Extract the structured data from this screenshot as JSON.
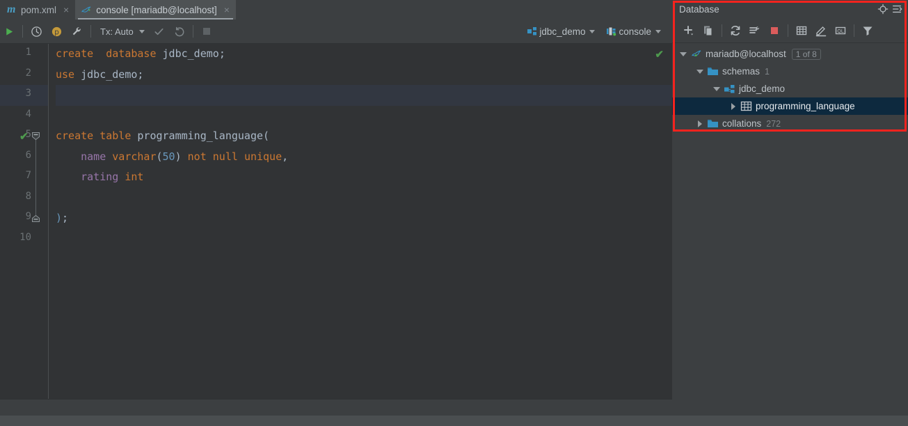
{
  "tabs": [
    {
      "label": "pom.xml",
      "icon": "maven-icon",
      "active": false,
      "close": "×"
    },
    {
      "label": "console [mariadb@localhost]",
      "icon": "mariadb-icon",
      "active": true,
      "close": "×"
    }
  ],
  "toolbar": {
    "run_icon": "run-icon",
    "history_icon": "history-icon",
    "params_icon": "parameters-icon",
    "wrench_icon": "wrench-icon",
    "tx_label": "Tx: Auto",
    "commit_icon": "commit-icon",
    "rollback_icon": "rollback-icon",
    "stop_icon": "stop-icon",
    "schema_label": "jdbc_demo",
    "schema_icon": "schema-icon",
    "session_label": "console",
    "session_icon": "session-icon"
  },
  "editor": {
    "inspection_status_icon": "inspection-ok-icon",
    "lines": [
      {
        "num": "1",
        "gutter_check": false,
        "fold": "",
        "highlight": false,
        "tokens": [
          {
            "t": "create",
            "c": "kw"
          },
          {
            "t": "  ",
            "c": "pun"
          },
          {
            "t": "database",
            "c": "kw"
          },
          {
            "t": " ",
            "c": "pun"
          },
          {
            "t": "jdbc_demo",
            "c": "id"
          },
          {
            "t": ";",
            "c": "pun"
          }
        ]
      },
      {
        "num": "2",
        "gutter_check": false,
        "fold": "",
        "highlight": false,
        "tokens": [
          {
            "t": "use",
            "c": "kw"
          },
          {
            "t": " ",
            "c": "pun"
          },
          {
            "t": "jdbc_demo",
            "c": "id"
          },
          {
            "t": ";",
            "c": "pun"
          }
        ]
      },
      {
        "num": "3",
        "gutter_check": false,
        "fold": "",
        "highlight": true,
        "tokens": []
      },
      {
        "num": "4",
        "gutter_check": false,
        "fold": "",
        "highlight": false,
        "tokens": []
      },
      {
        "num": "5",
        "gutter_check": true,
        "fold": "collapse",
        "highlight": false,
        "tokens": [
          {
            "t": "create",
            "c": "kw"
          },
          {
            "t": " ",
            "c": "pun"
          },
          {
            "t": "table",
            "c": "kw"
          },
          {
            "t": " ",
            "c": "pun"
          },
          {
            "t": "programming_language",
            "c": "id"
          },
          {
            "t": "(",
            "c": "pun"
          }
        ]
      },
      {
        "num": "6",
        "gutter_check": false,
        "fold": "",
        "highlight": false,
        "tokens": [
          {
            "t": "    ",
            "c": "pun"
          },
          {
            "t": "name",
            "c": "fld"
          },
          {
            "t": " ",
            "c": "pun"
          },
          {
            "t": "varchar",
            "c": "kw"
          },
          {
            "t": "(",
            "c": "pun"
          },
          {
            "t": "50",
            "c": "num"
          },
          {
            "t": ")",
            "c": "pun"
          },
          {
            "t": " ",
            "c": "pun"
          },
          {
            "t": "not",
            "c": "kw"
          },
          {
            "t": " ",
            "c": "pun"
          },
          {
            "t": "null",
            "c": "kw"
          },
          {
            "t": " ",
            "c": "pun"
          },
          {
            "t": "unique",
            "c": "kw"
          },
          {
            "t": ",",
            "c": "pun"
          }
        ]
      },
      {
        "num": "7",
        "gutter_check": false,
        "fold": "",
        "highlight": false,
        "tokens": [
          {
            "t": "    ",
            "c": "pun"
          },
          {
            "t": "rating",
            "c": "fld"
          },
          {
            "t": " ",
            "c": "pun"
          },
          {
            "t": "int",
            "c": "kw"
          }
        ]
      },
      {
        "num": "8",
        "gutter_check": false,
        "fold": "",
        "highlight": false,
        "tokens": []
      },
      {
        "num": "9",
        "gutter_check": false,
        "fold": "end",
        "highlight": false,
        "tokens": [
          {
            "t": ")",
            "c": "num"
          },
          {
            "t": ";",
            "c": "pun"
          }
        ]
      },
      {
        "num": "10",
        "gutter_check": false,
        "fold": "",
        "highlight": false,
        "tokens": []
      }
    ]
  },
  "database_panel": {
    "title": "Database",
    "header_icons": [
      "locate-icon",
      "hide-icon"
    ],
    "toolbar_icons": [
      "add-icon",
      "duplicate-icon",
      "refresh-icon",
      "sync-settings-icon",
      "stop-icon",
      "open-table-editor-icon",
      "modify-icon",
      "jump-to-query-console-icon",
      "filter-icon"
    ],
    "tree": [
      {
        "level": 0,
        "arrow": "down",
        "icon": "mariadb-connection-icon",
        "label": "mariadb@localhost",
        "badge": "1 of 8",
        "count": "",
        "selected": false
      },
      {
        "level": 1,
        "arrow": "down",
        "icon": "folder-icon",
        "label": "schemas",
        "badge": "",
        "count": "1",
        "selected": false
      },
      {
        "level": 2,
        "arrow": "down",
        "icon": "schema-icon",
        "label": "jdbc_demo",
        "badge": "",
        "count": "",
        "selected": false
      },
      {
        "level": 3,
        "arrow": "right",
        "icon": "table-icon",
        "label": "programming_language",
        "badge": "",
        "count": "",
        "selected": true
      },
      {
        "level": 1,
        "arrow": "right",
        "icon": "folder-icon",
        "label": "collations",
        "badge": "",
        "count": "272",
        "selected": false
      }
    ]
  },
  "annotation": {
    "color": "#f5231e",
    "shape": "rectangle"
  }
}
